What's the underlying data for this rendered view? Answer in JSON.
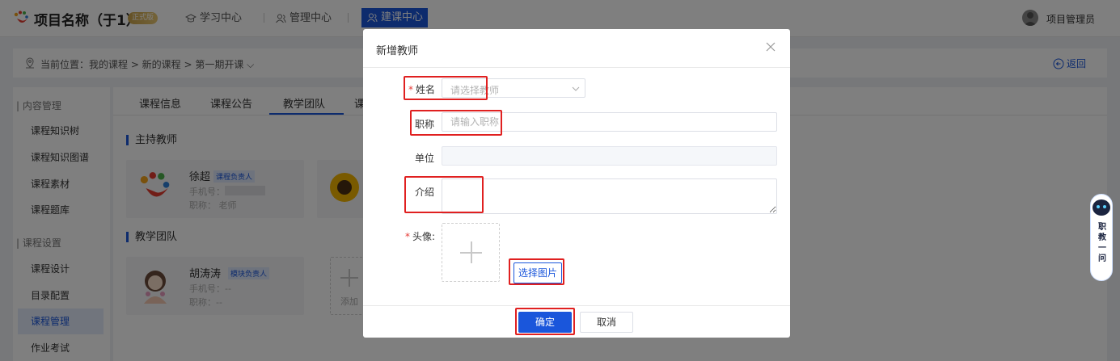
{
  "header": {
    "app_title": "项目名称（于1）",
    "trial_badge": "正式版",
    "nav": [
      {
        "label": "学习中心",
        "icon": "graduation-icon"
      },
      {
        "label": "管理中心",
        "icon": "users-icon"
      },
      {
        "label": "建课中心",
        "icon": "users-icon"
      }
    ],
    "user_name": "项目管理员"
  },
  "breadcrumb": {
    "text": "当前位置：我的课程 > 新的课程 > 第一期开课 ⌵",
    "back_label": "返回"
  },
  "sidebar": {
    "groups": [
      {
        "label": "| 内容管理",
        "items": [
          "课程知识树",
          "课程知识图谱",
          "课程素材",
          "课程题库"
        ]
      },
      {
        "label": "| 课程设置",
        "items": [
          "课程设计",
          "目录配置",
          "课程管理",
          "作业考试"
        ]
      }
    ],
    "active_item": "课程管理"
  },
  "main": {
    "tabs": [
      "课程信息",
      "课程公告",
      "教学团队",
      "课"
    ],
    "active_tab": "教学团队",
    "host_section": "主持教师",
    "team_section": "教学团队",
    "host_card": {
      "name": "徐超",
      "tag": "课程负责人",
      "phone": "手机号：1              70",
      "title": "职称：  老师"
    },
    "team_card": {
      "name": "胡涛涛",
      "tag": "模块负责人",
      "phone": "手机号：--",
      "title": "职称：--"
    },
    "add_label": "添加"
  },
  "dialog": {
    "title": "新增教师",
    "fields": {
      "name": {
        "label": "姓名",
        "placeholder": "请选择教师",
        "required": true
      },
      "title": {
        "label": "职称",
        "placeholder": "请输入职称"
      },
      "unit": {
        "label": "单位",
        "value": ""
      },
      "intro": {
        "label": "介绍",
        "value": ""
      },
      "avatar": {
        "label": "头像:",
        "required": true
      }
    },
    "select_image_label": "选择图片",
    "ok_label": "确定",
    "cancel_label": "取消"
  },
  "assistant": {
    "label": "职教一问"
  },
  "colors": {
    "primary": "#1a56db",
    "highlight": "#e02020",
    "required": "#e53935"
  }
}
